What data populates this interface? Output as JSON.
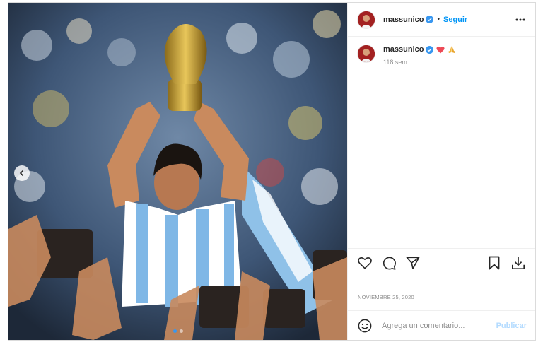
{
  "post": {
    "image_alt": "",
    "carousel": {
      "dots": 2,
      "active_index": 0
    }
  },
  "header": {
    "username": "massunico",
    "verified": true,
    "separator": "•",
    "follow_label": "Seguir",
    "more_icon": "more-horizontal-icon"
  },
  "caption": {
    "username": "massunico",
    "verified": true,
    "emojis": [
      "❤️",
      "🙏"
    ],
    "time_ago": "118 sem"
  },
  "actions": {
    "icons": [
      "heart-icon",
      "comment-icon",
      "share-icon",
      "bookmark-icon",
      "download-icon"
    ]
  },
  "date": "NOVIEMBRE 25, 2020",
  "add_comment": {
    "emoji_icon": "smiley-icon",
    "placeholder": "Agrega un comentario...",
    "publish_label": "Publicar"
  },
  "colors": {
    "accent": "#0095f6",
    "publish_disabled": "#b3dbff",
    "verified_badge": "#3897f0",
    "heart": "#ed4956"
  }
}
